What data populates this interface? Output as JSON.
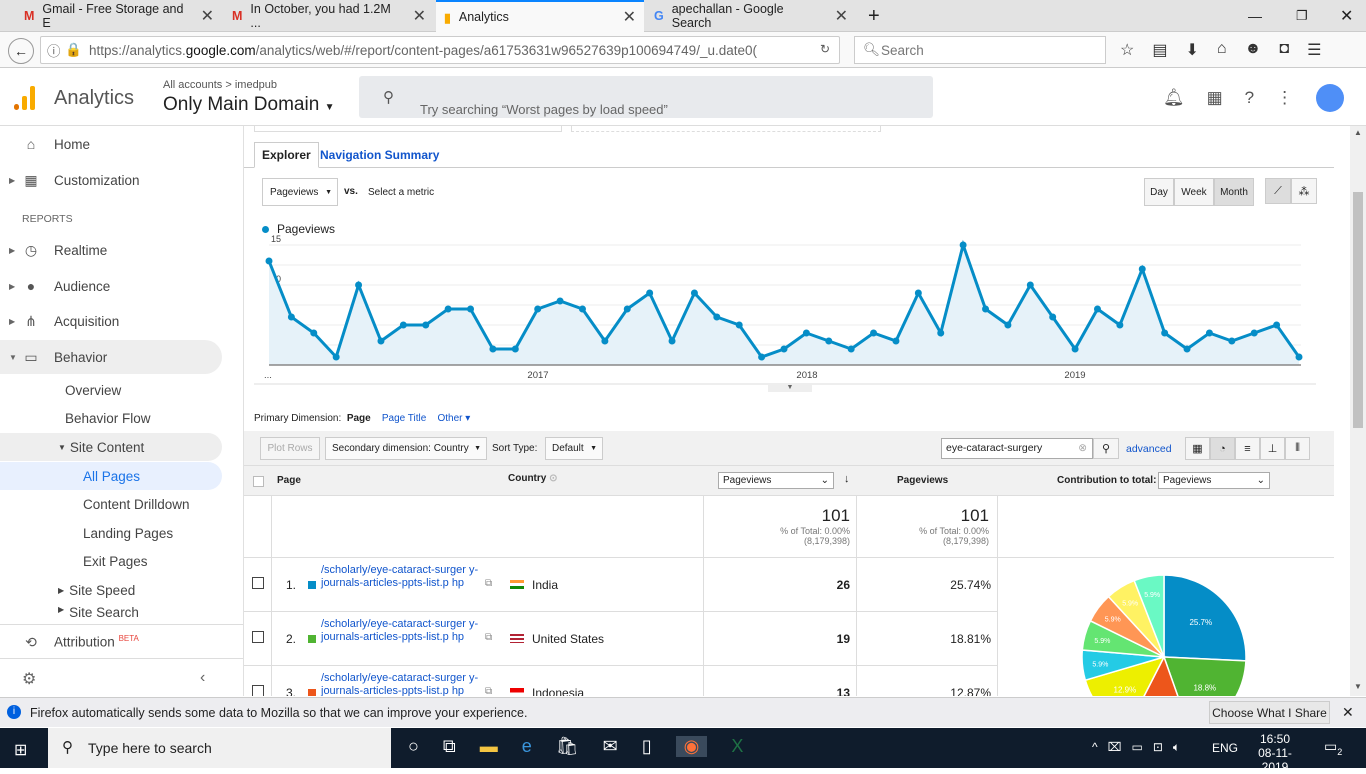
{
  "browser": {
    "tabs": [
      {
        "title": "Gmail - Free Storage and E",
        "icon": "gmail-icon"
      },
      {
        "title": "In October, you had 1.2M ...",
        "icon": "gmail-icon"
      },
      {
        "title": "Analytics",
        "icon": "analytics-icon",
        "active": true
      },
      {
        "title": "apechallan - Google Search",
        "icon": "google-icon"
      }
    ],
    "url_prefix": "https://analytics.",
    "url_domain": "google.com",
    "url_rest": "/analytics/web/#/report/content-pages/a61753631w96527639p100694749/_u.date0(",
    "search_placeholder": "Search"
  },
  "ga": {
    "product": "Analytics",
    "breadcrumb": "All accounts > imedpub",
    "property": "Only Main Domain",
    "search_placeholder": "Try searching “Worst pages by load speed”"
  },
  "sidebar": {
    "home": "Home",
    "customization": "Customization",
    "reports_heading": "REPORTS",
    "realtime": "Realtime",
    "audience": "Audience",
    "acquisition": "Acquisition",
    "behavior": "Behavior",
    "overview": "Overview",
    "behavior_flow": "Behavior Flow",
    "site_content": "Site Content",
    "all_pages": "All Pages",
    "content_drilldown": "Content Drilldown",
    "landing_pages": "Landing Pages",
    "exit_pages": "Exit Pages",
    "site_speed": "Site Speed",
    "site_search": "Site Search",
    "attribution": "Attribution",
    "beta": "BETA"
  },
  "report": {
    "tabs": [
      "Explorer",
      "Navigation Summary"
    ],
    "metric": "Pageviews",
    "vs": "vs.",
    "select_metric": "Select a metric",
    "periods": [
      "Day",
      "Week",
      "Month"
    ],
    "primary_dimension_label": "Primary Dimension:",
    "dims": [
      "Page",
      "Page Title",
      "Other"
    ],
    "plot_rows": "Plot Rows",
    "secondary_dimension": "Secondary dimension: Country",
    "sort_type_label": "Sort Type:",
    "sort_type": "Default",
    "filter_value": "eye-cataract-surgery",
    "advanced": "advanced",
    "col_page": "Page",
    "col_country": "Country",
    "col_metric_select": "Pageviews",
    "col_pageviews": "Pageviews",
    "contribution_label": "Contribution to total:",
    "contribution_select": "Pageviews",
    "total_value": "101",
    "total_pct": "% of Total: 0.00%",
    "total_of": "(8,179,398)",
    "rows": [
      {
        "n": "1.",
        "page": "/scholarly/eye-cataract-surger y-journals-articles-ppts-list.p hp",
        "country": "India",
        "flag": "india",
        "views": "26",
        "pct": "25.74%",
        "color": "#058dc7"
      },
      {
        "n": "2.",
        "page": "/scholarly/eye-cataract-surger y-journals-articles-ppts-list.p hp",
        "country": "United States",
        "flag": "us",
        "views": "19",
        "pct": "18.81%",
        "color": "#50b432"
      },
      {
        "n": "3.",
        "page": "/scholarly/eye-cataract-surger y-journals-articles-ppts-list.p hp",
        "country": "Indonesia",
        "flag": "indonesia",
        "views": "13",
        "pct": "12.87%",
        "color": "#ed561b"
      }
    ]
  },
  "chart_data": [
    {
      "type": "line",
      "title": "",
      "legend": "Pageviews",
      "ylim": [
        0,
        16
      ],
      "yticks": [
        "5",
        "10",
        "15"
      ],
      "xticks": [
        "...",
        "2017",
        "2018",
        "2019"
      ],
      "values": [
        13,
        6,
        4,
        1,
        10,
        3,
        5,
        5,
        7,
        7,
        2,
        2,
        7,
        8,
        7,
        3,
        7,
        9,
        3,
        9,
        6,
        5,
        1,
        2,
        4,
        3,
        2,
        4,
        3,
        9,
        4,
        15,
        7,
        5,
        10,
        6,
        2,
        7,
        5,
        12,
        4,
        2,
        4,
        3,
        4,
        5,
        1
      ],
      "color": "#058dc7"
    },
    {
      "type": "pie",
      "labels": [
        "25.7%",
        "18.8%",
        "",
        "12.9%",
        "5.9%",
        "5.9%",
        "5.9%",
        "5.9%",
        "5.9%"
      ],
      "values": [
        25.7,
        18.8,
        12.9,
        12.9,
        5.9,
        5.9,
        5.9,
        5.9,
        5.9
      ],
      "colors": [
        "#058dc7",
        "#50b432",
        "#ed561b",
        "#edef00",
        "#24cbe5",
        "#64e572",
        "#ff9655",
        "#fff263",
        "#6af9c4"
      ]
    }
  ],
  "infobar": {
    "message": "Firefox automatically sends some data to Mozilla so that we can improve your experience.",
    "button": "Choose What I Share"
  },
  "taskbar": {
    "search": "Type here to search",
    "lang": "ENG",
    "time": "16:50",
    "date": "08-11-2019",
    "notif": "2"
  }
}
